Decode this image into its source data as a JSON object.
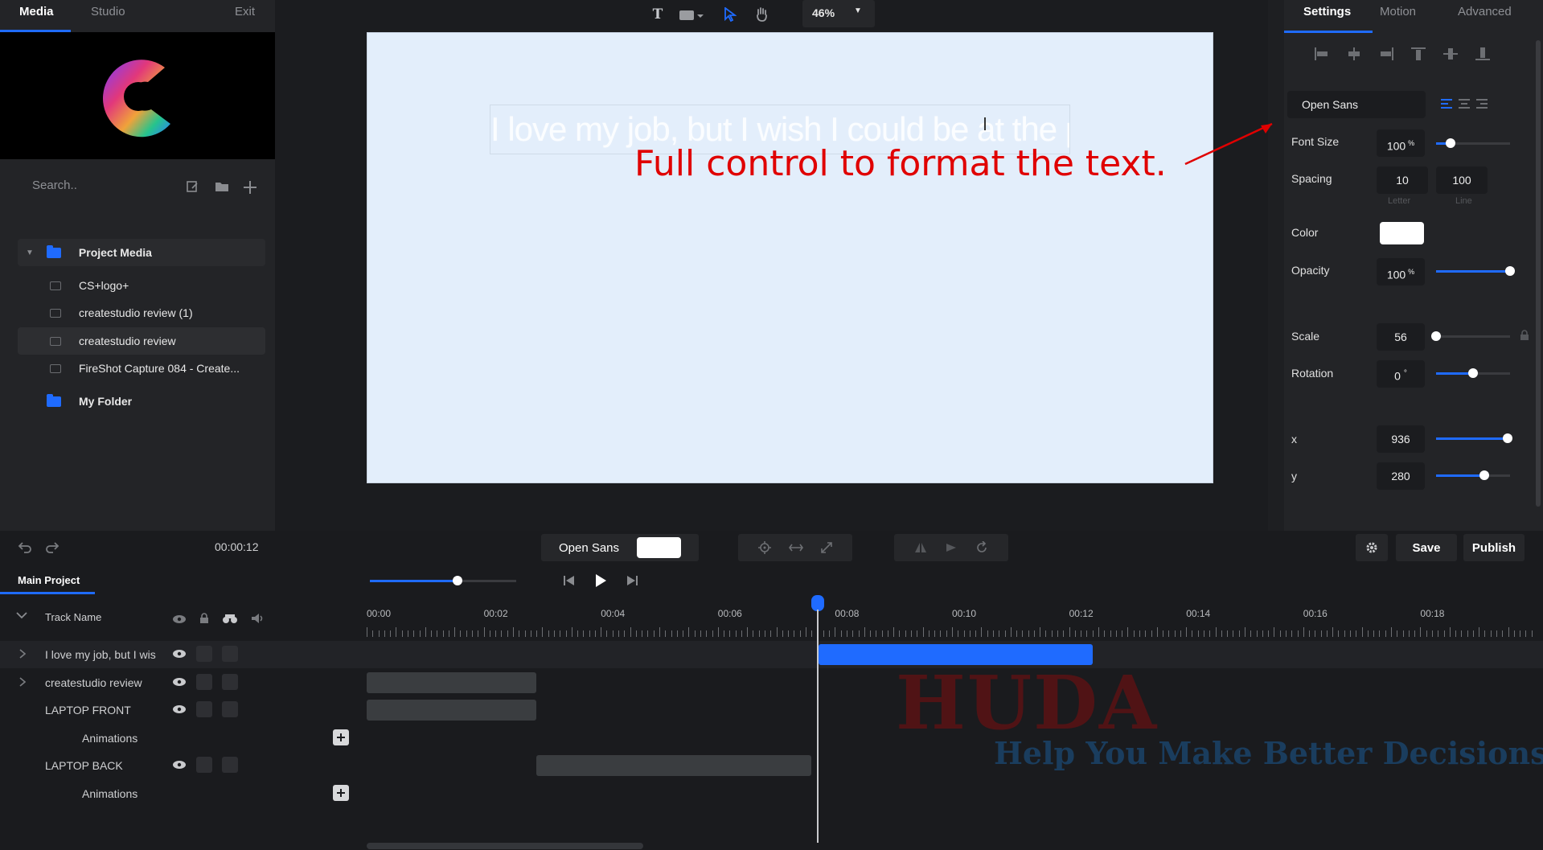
{
  "left_panel": {
    "tabs": [
      "Media",
      "Studio"
    ],
    "exit": "Exit",
    "search_placeholder": "Search..",
    "tree": {
      "project_folder": "Project Media",
      "items": [
        "CS+logo+",
        "createstudio review (1)",
        "createstudio review",
        "FireShot Capture 084 - Create..."
      ],
      "selected_index": 2,
      "other_folder": "My Folder"
    }
  },
  "toolbar": {
    "zoom": "46%",
    "text_tool_glyph": "T"
  },
  "canvas": {
    "text": "I love my job, but I wish I could be at the park more",
    "annotation": "Full control to format the text."
  },
  "right_panel": {
    "tabs": [
      "Settings",
      "Motion",
      "Advanced"
    ],
    "font": "Open Sans",
    "font_size": {
      "label": "Font Size",
      "value": "100",
      "unit": "%",
      "slider": 0.2
    },
    "spacing": {
      "label": "Spacing",
      "letter": "10",
      "line": "100",
      "letter_label": "Letter",
      "line_label": "Line"
    },
    "color": {
      "label": "Color",
      "value": "#ffffff"
    },
    "opacity": {
      "label": "Opacity",
      "value": "100",
      "unit": "%",
      "slider": 1.0
    },
    "scale": {
      "label": "Scale",
      "value": "56",
      "slider": 0.0
    },
    "rotation": {
      "label": "Rotation",
      "value": "0",
      "unit": "°",
      "slider": 0.5
    },
    "x": {
      "label": "x",
      "value": "936",
      "slider": 0.97
    },
    "y": {
      "label": "y",
      "value": "280",
      "slider": 0.65
    }
  },
  "controls": {
    "time": "00:00:12",
    "font_chip": "Open Sans",
    "save": "Save",
    "publish": "Publish"
  },
  "timeline": {
    "tab": "Main Project",
    "track_header": "Track Name",
    "ticks": [
      "00:00",
      "00:02",
      "00:04",
      "00:06",
      "00:08",
      "00:10",
      "00:12",
      "00:14",
      "00:16",
      "00:18"
    ],
    "playhead_seconds": 7.6,
    "tracks": [
      {
        "name": "I love my job, but I wish",
        "expandable": true,
        "clip_start": 7.6,
        "clip_end": 12.4,
        "active": true
      },
      {
        "name": "createstudio review",
        "expandable": true,
        "clip_start": 0,
        "clip_end": 2.9
      },
      {
        "name": "LAPTOP FRONT",
        "expandable": false,
        "clip_start": 0,
        "clip_end": 2.9
      },
      {
        "name": "Animations",
        "sub": true
      },
      {
        "name": "LAPTOP BACK",
        "expandable": false,
        "clip_start": 2.9,
        "clip_end": 7.6
      },
      {
        "name": "Animations",
        "sub": true
      }
    ],
    "volume_slider": 0.6
  },
  "watermark": {
    "title": "HUDA",
    "tagline": "Help You Make Better Decisions"
  }
}
